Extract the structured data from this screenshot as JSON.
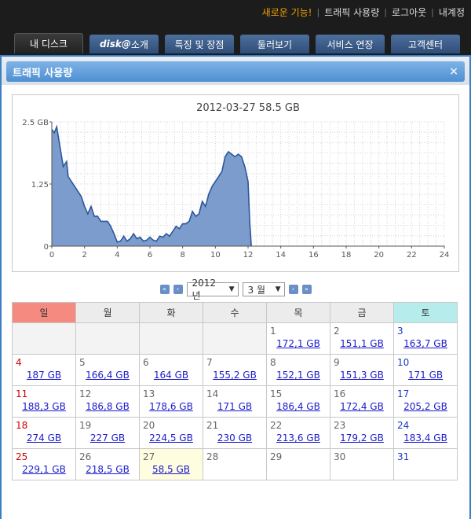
{
  "top_links": [
    {
      "label": "새로운 기능!",
      "highlight": true
    },
    {
      "label": "트래픽 사용량",
      "highlight": false
    },
    {
      "label": "로그아웃",
      "highlight": false
    },
    {
      "label": "내계정",
      "highlight": false
    }
  ],
  "tabs": {
    "my_disk": "내 디스크",
    "intro_brand": "disk@",
    "intro_suffix": " 소개",
    "features": "특징 및 장점",
    "tour": "둘러보기",
    "extend": "서비스 연장",
    "support": "고객센터"
  },
  "panel": {
    "title": "트래픽 사용량",
    "close": "×"
  },
  "chart_data": {
    "type": "area",
    "title": "2012-03-27 58.5 GB",
    "xlabel": "",
    "ylabel": "",
    "xlim": [
      0,
      24
    ],
    "ylim": [
      0,
      2.5
    ],
    "x_ticks": [
      0,
      2,
      4,
      6,
      8,
      10,
      12,
      14,
      16,
      18,
      20,
      22,
      24
    ],
    "y_ticks": [
      {
        "value": 0,
        "label": "0"
      },
      {
        "value": 1.25,
        "label": "1.25"
      },
      {
        "value": 2.5,
        "label": "2.5 GB"
      }
    ],
    "grid": true,
    "colors": {
      "fill": "#7b9ccd",
      "line": "#2b579a"
    },
    "x": [
      0,
      0.15,
      0.3,
      0.5,
      0.7,
      0.9,
      1.0,
      1.2,
      1.4,
      1.6,
      1.8,
      2.0,
      2.2,
      2.4,
      2.6,
      2.8,
      3.0,
      3.2,
      3.4,
      3.6,
      3.8,
      4.0,
      4.2,
      4.4,
      4.6,
      4.8,
      5.0,
      5.2,
      5.4,
      5.6,
      5.8,
      6.0,
      6.2,
      6.4,
      6.6,
      6.8,
      7.0,
      7.2,
      7.4,
      7.6,
      7.8,
      8.0,
      8.2,
      8.4,
      8.6,
      8.8,
      9.0,
      9.2,
      9.4,
      9.6,
      9.8,
      10.0,
      10.2,
      10.4,
      10.6,
      10.8,
      11.0,
      11.2,
      11.4,
      11.6,
      11.8,
      12.0,
      12.1,
      12.2
    ],
    "y": [
      2.35,
      2.28,
      2.4,
      2.0,
      1.6,
      1.7,
      1.4,
      1.3,
      1.2,
      1.1,
      1.0,
      0.8,
      0.65,
      0.8,
      0.6,
      0.6,
      0.5,
      0.5,
      0.5,
      0.4,
      0.25,
      0.08,
      0.1,
      0.2,
      0.1,
      0.15,
      0.25,
      0.15,
      0.18,
      0.1,
      0.12,
      0.18,
      0.12,
      0.1,
      0.2,
      0.18,
      0.25,
      0.2,
      0.3,
      0.4,
      0.35,
      0.45,
      0.45,
      0.5,
      0.7,
      0.6,
      0.65,
      0.9,
      0.8,
      1.05,
      1.2,
      1.3,
      1.4,
      1.5,
      1.8,
      1.9,
      1.85,
      1.8,
      1.85,
      1.8,
      1.6,
      1.3,
      0.5,
      0.0
    ]
  },
  "calendar_nav": {
    "first": "«",
    "prev": "‹",
    "next": "›",
    "last": "»",
    "year": "2012 년",
    "month": "3 월"
  },
  "weekdays": [
    "일",
    "월",
    "화",
    "수",
    "목",
    "금",
    "토"
  ],
  "weeks": [
    [
      null,
      null,
      null,
      null,
      {
        "day": "1",
        "usage": "172,1 GB"
      },
      {
        "day": "2",
        "usage": "151,1 GB"
      },
      {
        "day": "3",
        "usage": "163,7 GB"
      }
    ],
    [
      {
        "day": "4",
        "usage": "187 GB"
      },
      {
        "day": "5",
        "usage": "166,4 GB"
      },
      {
        "day": "6",
        "usage": "164 GB"
      },
      {
        "day": "7",
        "usage": "155,2 GB"
      },
      {
        "day": "8",
        "usage": "152,1 GB"
      },
      {
        "day": "9",
        "usage": "151,3 GB"
      },
      {
        "day": "10",
        "usage": "171 GB"
      }
    ],
    [
      {
        "day": "11",
        "usage": "188,3 GB"
      },
      {
        "day": "12",
        "usage": "186,8 GB"
      },
      {
        "day": "13",
        "usage": "178,6 GB"
      },
      {
        "day": "14",
        "usage": "171 GB"
      },
      {
        "day": "15",
        "usage": "186,4 GB"
      },
      {
        "day": "16",
        "usage": "172,4 GB"
      },
      {
        "day": "17",
        "usage": "205,2 GB"
      }
    ],
    [
      {
        "day": "18",
        "usage": "274 GB"
      },
      {
        "day": "19",
        "usage": "227 GB"
      },
      {
        "day": "20",
        "usage": "224,5 GB"
      },
      {
        "day": "21",
        "usage": "230 GB"
      },
      {
        "day": "22",
        "usage": "213,6 GB"
      },
      {
        "day": "23",
        "usage": "179,2 GB"
      },
      {
        "day": "24",
        "usage": "183,4 GB"
      }
    ],
    [
      {
        "day": "25",
        "usage": "229,1 GB"
      },
      {
        "day": "26",
        "usage": "218,5 GB"
      },
      {
        "day": "27",
        "usage": "58,5 GB",
        "today": true
      },
      {
        "day": "28",
        "usage": ""
      },
      {
        "day": "29",
        "usage": ""
      },
      {
        "day": "30",
        "usage": ""
      },
      {
        "day": "31",
        "usage": ""
      }
    ]
  ]
}
